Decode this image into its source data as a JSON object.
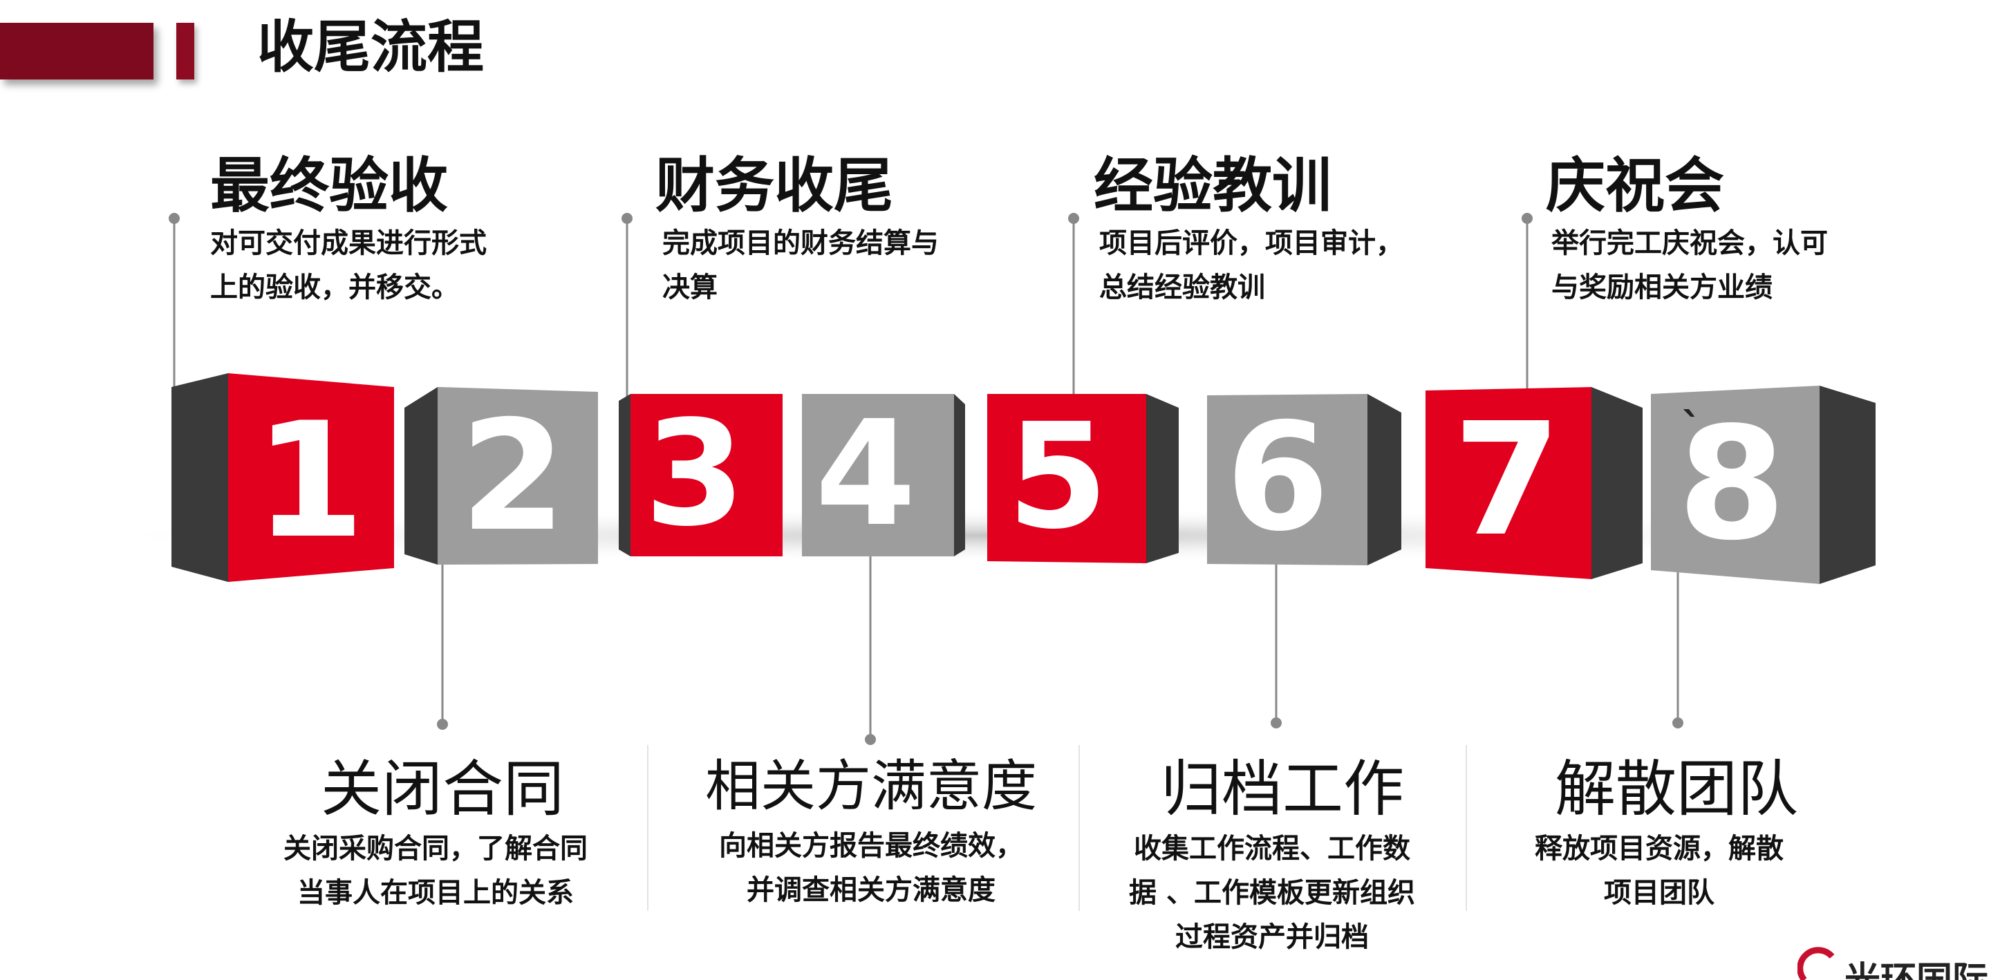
{
  "title": "收尾流程",
  "cubes": [
    {
      "num": "1",
      "color": "#e1001e"
    },
    {
      "num": "2",
      "color": "#9d9d9d"
    },
    {
      "num": "3",
      "color": "#e1001e"
    },
    {
      "num": "4",
      "color": "#9d9d9d"
    },
    {
      "num": "5",
      "color": "#e1001e"
    },
    {
      "num": "6",
      "color": "#9d9d9d"
    },
    {
      "num": "7",
      "color": "#e1001e"
    },
    {
      "num": "8",
      "color": "#9d9d9d"
    }
  ],
  "cube_mark": "`",
  "top_steps": [
    {
      "title": "最终验收",
      "desc_lines": [
        "对可交付成果进行形式",
        "上的验收，并移交。"
      ]
    },
    {
      "title": "财务收尾",
      "desc_lines": [
        "完成项目的财务结算与",
        "决算"
      ]
    },
    {
      "title": "经验教训",
      "desc_lines": [
        "项目后评价，项目审计，",
        "总结经验教训"
      ]
    },
    {
      "title": "庆祝会",
      "desc_lines": [
        "举行完工庆祝会，认可",
        "与奖励相关方业绩"
      ]
    }
  ],
  "bottom_steps": [
    {
      "title": "关闭合同",
      "desc_lines": [
        "关闭采购合同，了解合同",
        "当事人在项目上的关系"
      ]
    },
    {
      "title": "相关方满意度",
      "desc_lines": [
        "向相关方报告最终绩效，",
        "并调查相关方满意度"
      ]
    },
    {
      "title": "归档工作",
      "desc_lines": [
        "收集工作流程、工作数",
        "据 、工作模板更新组织",
        "过程资产并归档"
      ]
    },
    {
      "title": "解散团队",
      "desc_lines": [
        "释放项目资源，解散",
        "项目团队"
      ]
    }
  ],
  "colors": {
    "red": "#e1001e",
    "grey": "#9d9d9d",
    "dark_side": "#3a3a3a",
    "header": "#7d0a1e"
  },
  "logo_text": "光环国际"
}
